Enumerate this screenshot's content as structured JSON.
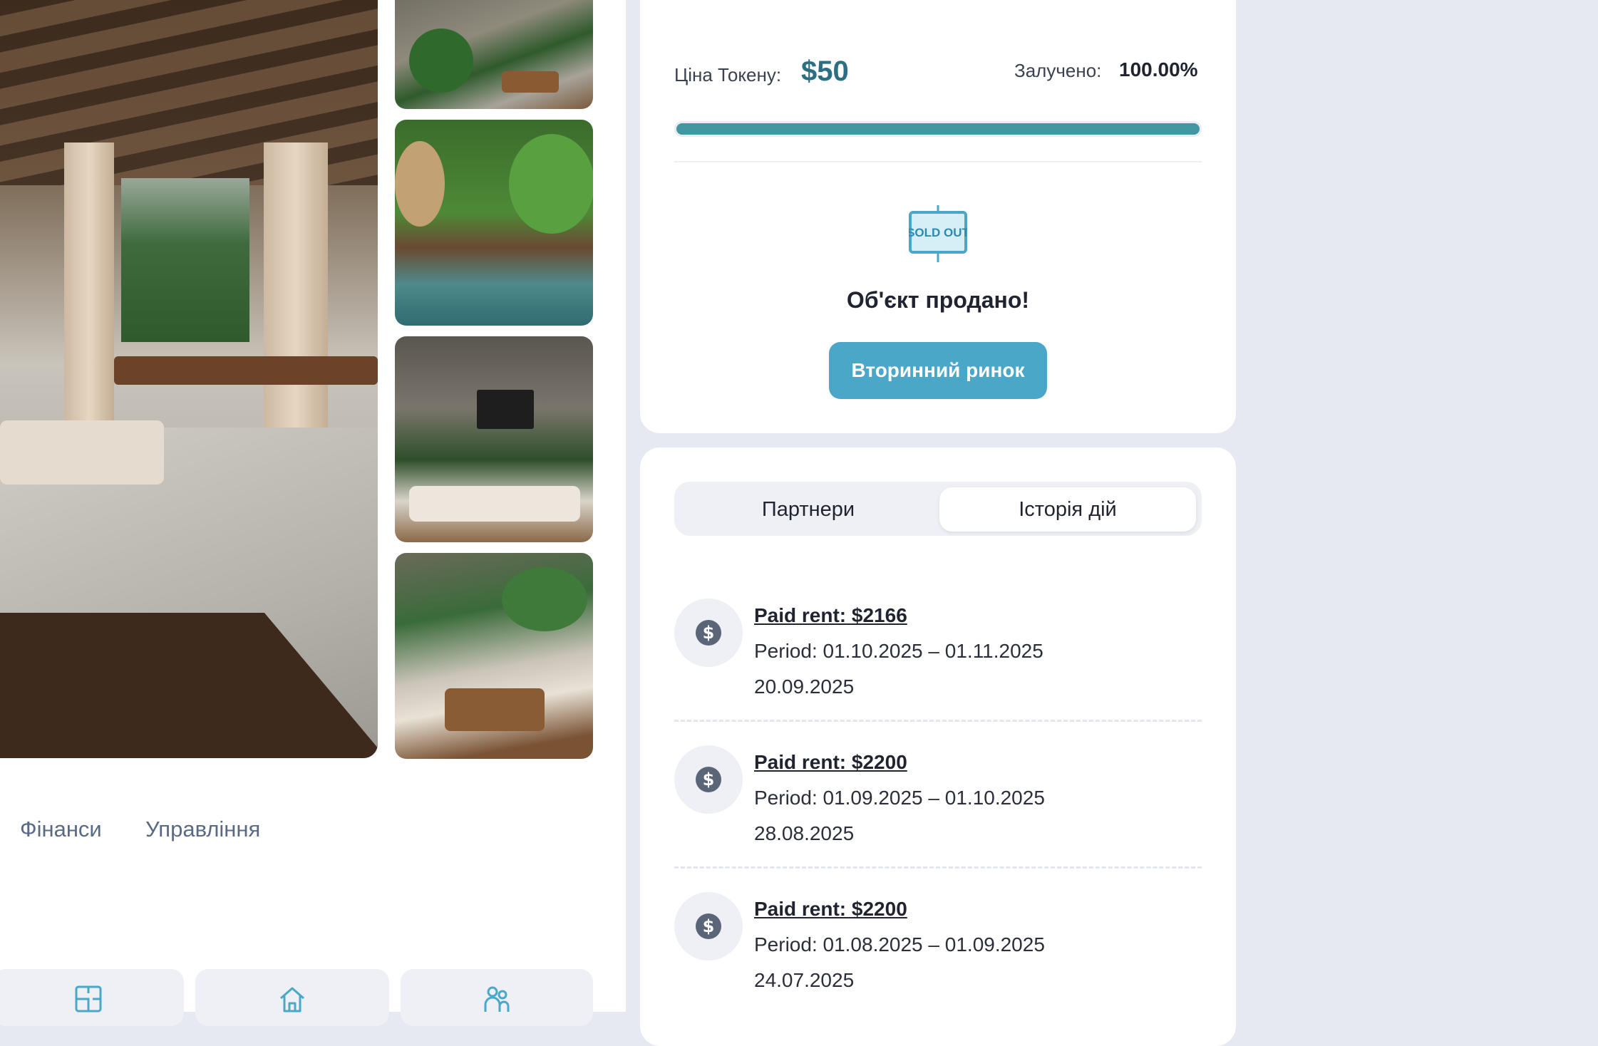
{
  "gallery": {
    "main_photo": "living-room-photo",
    "thumbnails": [
      "patio-photo",
      "outdoor-shower-pool-photo",
      "tv-lounge-photo",
      "sunken-lounge-photo"
    ]
  },
  "property_tabs": [
    {
      "label": "Фінанси"
    },
    {
      "label": "Управління"
    }
  ],
  "feature_cards": [
    {
      "icon": "floorplan-icon"
    },
    {
      "icon": "home-icon"
    },
    {
      "icon": "people-icon"
    }
  ],
  "token": {
    "price_label": "Ціна Токену:",
    "price_value": "$50",
    "raised_label": "Залучено:",
    "raised_value": "100.00%",
    "progress_fraction": 1.0
  },
  "status": {
    "badge_text": "SOLD OUT",
    "title": "Об'єкт продано!",
    "button_label": "Вторинний ринок"
  },
  "colors": {
    "accent": "#4aa7c8",
    "price": "#2b6f84",
    "progress": "#4397a3"
  },
  "history_tabs": {
    "tabs": [
      {
        "label": "Партнери",
        "active": false
      },
      {
        "label": "Історія дій",
        "active": true
      }
    ]
  },
  "history": [
    {
      "icon": "dollar-icon",
      "title": "Paid rent: $2166",
      "period": "Period: 01.10.2025 – 01.11.2025",
      "date": "20.09.2025"
    },
    {
      "icon": "dollar-icon",
      "title": "Paid rent: $2200",
      "period": "Period: 01.09.2025 – 01.10.2025",
      "date": "28.08.2025"
    },
    {
      "icon": "dollar-icon",
      "title": "Paid rent: $2200",
      "period": "Period: 01.08.2025 – 01.09.2025",
      "date": "24.07.2025"
    }
  ]
}
